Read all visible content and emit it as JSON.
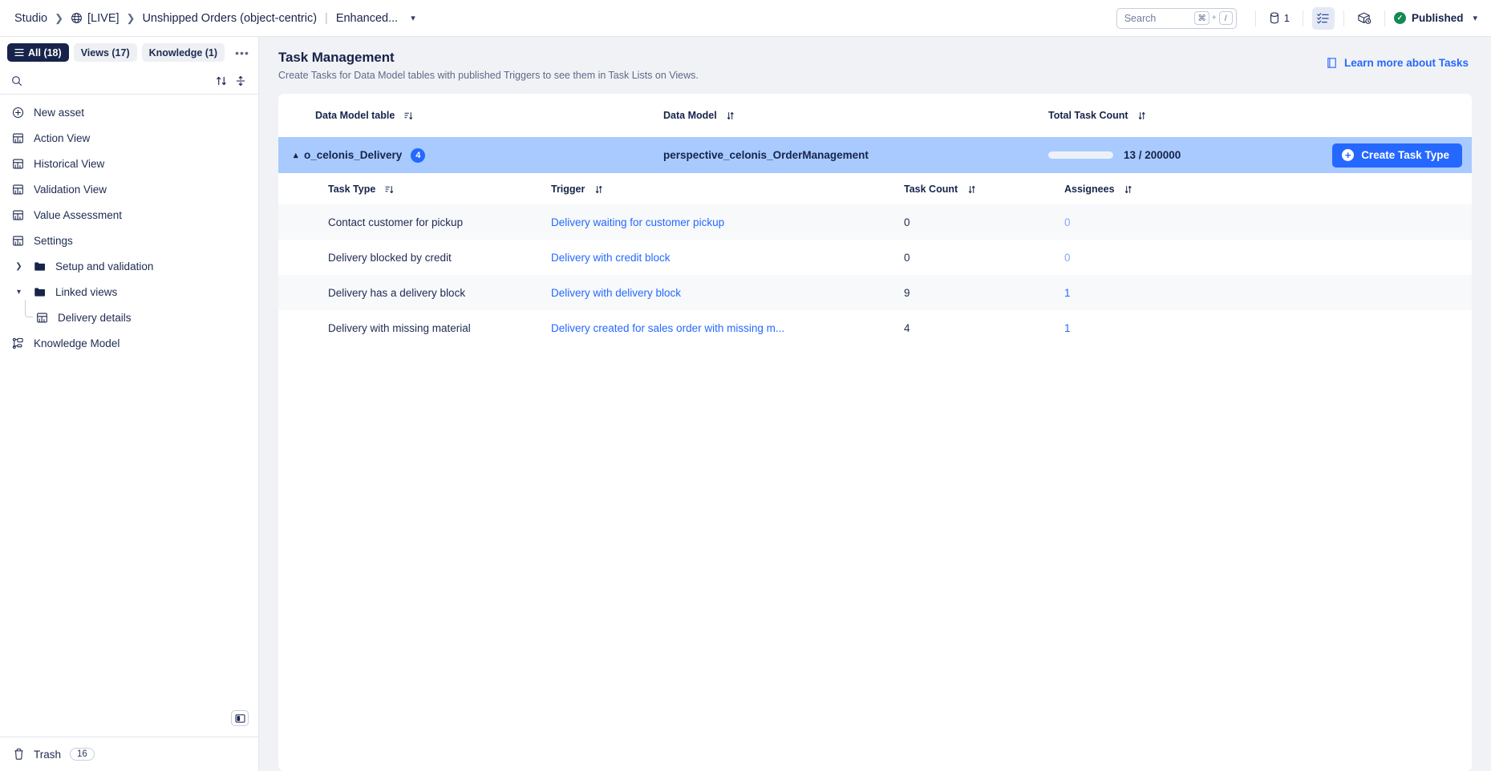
{
  "topbar": {
    "breadcrumbs": [
      {
        "label": "Studio",
        "icon": null
      },
      {
        "label": "[LIVE]",
        "icon": "globe-icon"
      },
      {
        "label": "Unshipped Orders (object-centric)",
        "suffix": "Enhanced...",
        "icon": null
      }
    ],
    "search": {
      "placeholder": "Search",
      "key_modifier": "⌘",
      "key_plus": "+",
      "key_slash": "/"
    },
    "data_model_count": "1",
    "data_model_icon": "database-icon",
    "task_list_icon": "task-list-icon",
    "environment_icon": "package-clock-icon",
    "status": {
      "label": "Published",
      "icon": "check-circle-icon",
      "color": "#128a52"
    },
    "chevron_icon": "chevron-down-icon"
  },
  "sidebar": {
    "tabs": [
      {
        "label": "All (18)",
        "selected": true,
        "icon": "list-icon"
      },
      {
        "label": "Views (17)",
        "selected": false
      },
      {
        "label": "Knowledge (1)",
        "selected": false
      }
    ],
    "more_label": "•••",
    "search": {
      "placeholder": "",
      "icon": "search-icon"
    },
    "sort_icon": "sort-icon",
    "expand_icon": "expand-collapse-icon",
    "items": [
      {
        "label": "New asset",
        "icon": "plus-circle-icon",
        "type": "action"
      },
      {
        "label": "Action View",
        "icon": "view-icon",
        "type": "view"
      },
      {
        "label": "Historical View",
        "icon": "view-icon",
        "type": "view"
      },
      {
        "label": "Validation View",
        "icon": "view-icon",
        "type": "view"
      },
      {
        "label": "Value Assessment",
        "icon": "view-icon",
        "type": "view"
      },
      {
        "label": "Settings",
        "icon": "view-icon",
        "type": "view"
      },
      {
        "label": "Setup and validation",
        "icon": "folder-icon",
        "type": "folder",
        "expanded": false
      },
      {
        "label": "Linked views",
        "icon": "folder-icon",
        "type": "folder",
        "expanded": true
      },
      {
        "label": "Delivery details",
        "icon": "view-icon",
        "type": "child"
      },
      {
        "label": "Knowledge Model",
        "icon": "knowledge-model-icon",
        "type": "view"
      }
    ],
    "collapse_icon": "collapse-sidebar-icon",
    "trash": {
      "label": "Trash",
      "count": "16",
      "icon": "trash-icon"
    }
  },
  "main": {
    "title": "Task Management",
    "subtitle": "Create Tasks for Data Model tables with published Triggers to see them in Task Lists on Views.",
    "learn_more": {
      "label": "Learn more about Tasks",
      "icon": "book-icon"
    },
    "group_columns": [
      {
        "label": "Data Model table",
        "sort": "sort-asc-icon"
      },
      {
        "label": "Data Model",
        "sort": "sort-icon"
      },
      {
        "label": "Total Task Count",
        "sort": "sort-icon"
      }
    ],
    "group": {
      "caret_icon": "chevron-up-icon",
      "table_name": "o_celonis_Delivery",
      "badge": "4",
      "data_model": "perspective_celonis_OrderManagement",
      "task_count_text": "13 / 200000",
      "progress_pct": 0,
      "create_button": {
        "label": "Create Task Type",
        "icon": "plus-icon"
      }
    },
    "sub_columns": [
      {
        "label": "Task Type",
        "sort": "sort-asc-icon"
      },
      {
        "label": "Trigger",
        "sort": "sort-icon"
      },
      {
        "label": "Task Count",
        "sort": "sort-icon"
      },
      {
        "label": "Assignees",
        "sort": "sort-icon"
      }
    ],
    "rows": [
      {
        "task_type": "Contact customer for pickup",
        "trigger": "Delivery waiting for customer pickup",
        "task_count": "0",
        "assignees": "0",
        "assignees_zero": true
      },
      {
        "task_type": "Delivery blocked by credit",
        "trigger": "Delivery with credit block",
        "task_count": "0",
        "assignees": "0",
        "assignees_zero": true
      },
      {
        "task_type": "Delivery has a delivery block",
        "trigger": "Delivery with delivery block",
        "task_count": "9",
        "assignees": "1",
        "assignees_zero": false
      },
      {
        "task_type": "Delivery with missing material",
        "trigger": "Delivery created for sales order with missing m...",
        "task_count": "4",
        "assignees": "1",
        "assignees_zero": false
      }
    ]
  },
  "colors": {
    "accent": "#2568ff",
    "group_row": "#a8caff",
    "navy": "#17234a",
    "published": "#128a52"
  }
}
